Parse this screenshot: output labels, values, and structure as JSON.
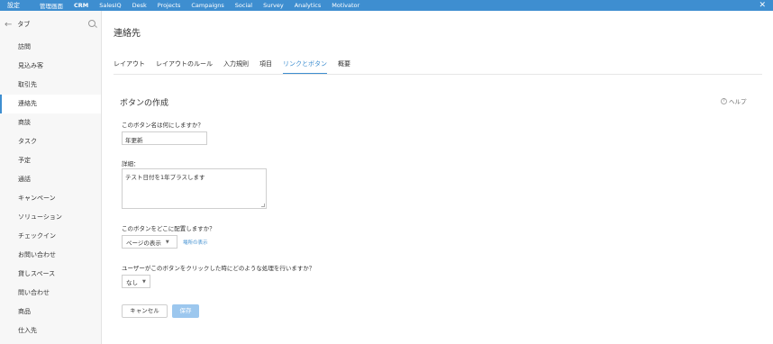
{
  "topbar": {
    "settings": "設定",
    "nav": [
      "管理画面",
      "CRM",
      "SalesIQ",
      "Desk",
      "Projects",
      "Campaigns",
      "Social",
      "Survey",
      "Analytics",
      "Motivator"
    ],
    "active": "CRM",
    "close": "✕"
  },
  "sidebar": {
    "header": "タブ",
    "items": [
      "訪問",
      "見込み客",
      "取引先",
      "連絡先",
      "商談",
      "タスク",
      "予定",
      "通話",
      "キャンペーン",
      "ソリューション",
      "チェックイン",
      "お問い合わせ",
      "貸しスペース",
      "問い合わせ",
      "商品",
      "仕入先"
    ],
    "active_index": 3
  },
  "main": {
    "title": "連絡先",
    "tabs": [
      "レイアウト",
      "レイアウトのルール",
      "入力規則",
      "項目",
      "リンクとボタン",
      "概要"
    ],
    "active_tab_index": 4,
    "section_title": "ボタンの作成",
    "help": "ヘルプ"
  },
  "form": {
    "name_label": "このボタン名は何にしますか？",
    "name_value": "年更新",
    "detail_label": "詳細：",
    "detail_value": "テスト日付を1年プラスします",
    "placement_label": "このボタンをどこに配置しますか？",
    "placement_value": "ページの表示",
    "placement_link": "場所の表示",
    "action_label": "ユーザーがこのボタンをクリックした時にどのような処理を行いますか？",
    "action_value": "なし",
    "cancel": "キャンセル",
    "save": "保存"
  }
}
